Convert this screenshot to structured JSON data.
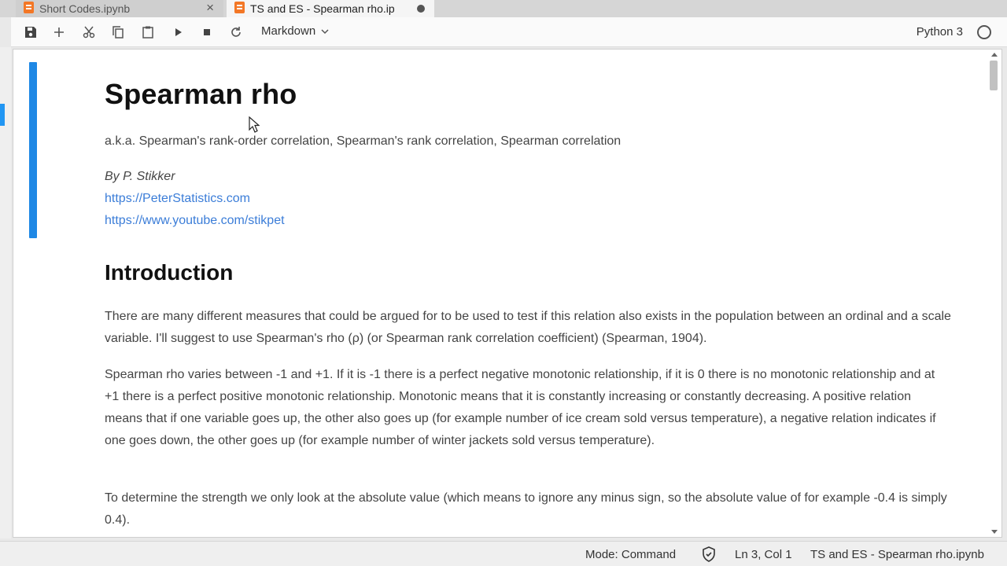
{
  "tabs": [
    {
      "label": "Short Codes.ipynb",
      "close_glyph": "×"
    },
    {
      "label": "TS and ES - Spearman rho.ip"
    }
  ],
  "toolbar": {
    "cell_type": "Markdown",
    "kernel_name": "Python 3"
  },
  "notebook": {
    "title": "Spearman rho",
    "aka": "a.k.a. Spearman's rank-order correlation, Spearman's rank correlation, Spearman correlation",
    "author": "By P. Stikker",
    "links": [
      "https://PeterStatistics.com",
      "https://www.youtube.com/stikpet"
    ],
    "intro_heading": "Introduction",
    "paragraphs": [
      "There are many different measures that could be argued for to be used to test if this relation also exists in the population between an ordinal and a scale variable. I'll suggest to use Spearman's rho (ρ) (or Spearman rank correlation coefficient) (Spearman, 1904).",
      "Spearman rho varies between -1 and +1. If it is -1 there is a perfect negative monotonic relationship, if it is 0 there is no monotonic relationship and at +1 there is a perfect positive monotonic relationship. Monotonic means that it is constantly increasing or constantly decreasing. A positive relation means that if one variable goes up, the other also goes up (for example number of ice cream sold versus temperature), a negative relation indicates if one goes down, the other goes up (for example number of winter jackets sold versus temperature).",
      "To determine the strength we only look at the absolute value (which means to ignore any minus sign, so the absolute value of for example -0.4 is simply 0.4)."
    ]
  },
  "statusbar": {
    "mode": "Mode: Command",
    "position": "Ln 3, Col 1",
    "file": "TS and ES - Spearman rho.ipynb"
  },
  "icons": {
    "save": "save-icon",
    "add": "plus-icon",
    "cut": "scissors-icon",
    "copy": "copy-icon",
    "paste": "clipboard-icon",
    "run": "play-icon",
    "stop": "stop-icon",
    "restart": "refresh-icon",
    "dropdown": "chevron-down-icon",
    "kernel_status": "circle-icon",
    "trust": "shield-icon"
  },
  "colors": {
    "accent": "#1e88e5",
    "link": "#3b7dd8",
    "notebook_icon": "#f37726"
  }
}
